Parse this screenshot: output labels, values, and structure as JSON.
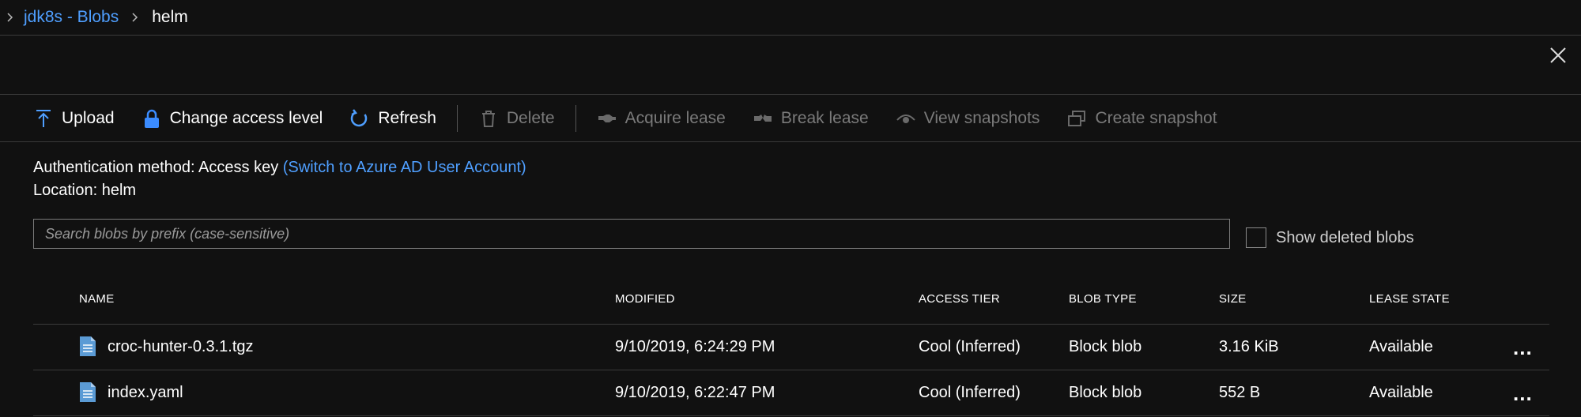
{
  "breadcrumb": {
    "items": [
      {
        "label": "jdk8s - Blobs"
      },
      {
        "label": "helm"
      }
    ]
  },
  "toolbar": {
    "upload": "Upload",
    "change_access": "Change access level",
    "refresh": "Refresh",
    "delete": "Delete",
    "acquire_lease": "Acquire lease",
    "break_lease": "Break lease",
    "view_snapshots": "View snapshots",
    "create_snapshot": "Create snapshot"
  },
  "info": {
    "auth_label": "Authentication method:",
    "auth_value": "Access key",
    "auth_switch": "(Switch to Azure AD User Account)",
    "location_label": "Location:",
    "location_value": "helm"
  },
  "search": {
    "placeholder": "Search blobs by prefix (case-sensitive)",
    "value": ""
  },
  "show_deleted": {
    "label": "Show deleted blobs",
    "checked": false
  },
  "table": {
    "headers": {
      "name": "NAME",
      "modified": "MODIFIED",
      "access_tier": "ACCESS TIER",
      "blob_type": "BLOB TYPE",
      "size": "SIZE",
      "lease_state": "LEASE STATE"
    },
    "rows": [
      {
        "name": "croc-hunter-0.3.1.tgz",
        "modified": "9/10/2019, 6:24:29 PM",
        "access_tier": "Cool (Inferred)",
        "blob_type": "Block blob",
        "size": "3.16 KiB",
        "lease_state": "Available",
        "more": "..."
      },
      {
        "name": "index.yaml",
        "modified": "9/10/2019, 6:22:47 PM",
        "access_tier": "Cool (Inferred)",
        "blob_type": "Block blob",
        "size": "552 B",
        "lease_state": "Available",
        "more": "..."
      }
    ]
  },
  "colors": {
    "background": "#111111",
    "link": "#4f9fff",
    "disabled": "#7a7a7a",
    "divider": "#3a3a3a"
  }
}
